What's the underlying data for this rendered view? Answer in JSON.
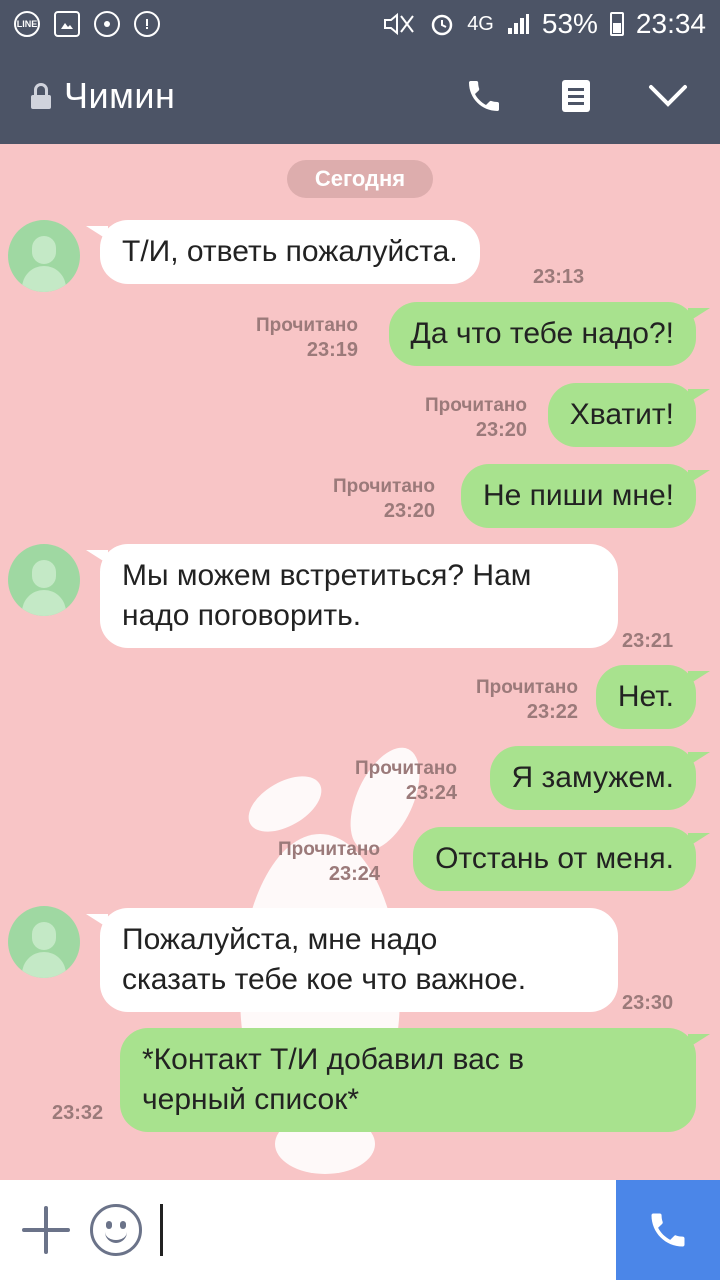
{
  "status_bar": {
    "icons_left": [
      "line-app-icon",
      "gallery-icon",
      "chrome-icon",
      "settings-alert-icon"
    ],
    "line_label": "LINE",
    "network": "4G",
    "battery": "53%",
    "time": "23:34"
  },
  "header": {
    "title": "Чимин",
    "icons": [
      "lock-icon",
      "phone-icon",
      "notes-icon",
      "chevron-down-icon"
    ]
  },
  "chat": {
    "date_label": "Сегодня",
    "messages": [
      {
        "dir": "in",
        "text": "Т/И, ответь пожалуйста.",
        "time": "23:13"
      },
      {
        "dir": "out",
        "text": "Да что тебе надо?!",
        "read": "Прочитано",
        "time": "23:19"
      },
      {
        "dir": "out",
        "text": "Хватит!",
        "read": "Прочитано",
        "time": "23:20"
      },
      {
        "dir": "out",
        "text": "Не пиши мне!",
        "read": "Прочитано",
        "time": "23:20"
      },
      {
        "dir": "in",
        "text": "Мы можем встретиться? Нам\nнадо поговорить.",
        "time": "23:21"
      },
      {
        "dir": "out",
        "text": "Нет.",
        "read": "Прочитано",
        "time": "23:22"
      },
      {
        "dir": "out",
        "text": "Я замужем.",
        "read": "Прочитано",
        "time": "23:24"
      },
      {
        "dir": "out",
        "text": "Отстань от меня.",
        "read": "Прочитано",
        "time": "23:24"
      },
      {
        "dir": "in",
        "text": "Пожалуйста, мне надо\nсказать тебе кое что важное.",
        "time": "23:30"
      },
      {
        "dir": "out",
        "text": "*Контакт Т/И добавил вас в\nчерный список*",
        "time": "23:32"
      }
    ]
  },
  "input_bar": {
    "placeholder": "",
    "icons": [
      "plus-icon",
      "emoji-icon",
      "call-icon"
    ]
  },
  "colors": {
    "header_bg": "#4c5466",
    "chat_bg": "#f8c5c6",
    "bubble_in": "#ffffff",
    "bubble_out": "#a8e28e",
    "send_bg": "#4b86e8"
  }
}
